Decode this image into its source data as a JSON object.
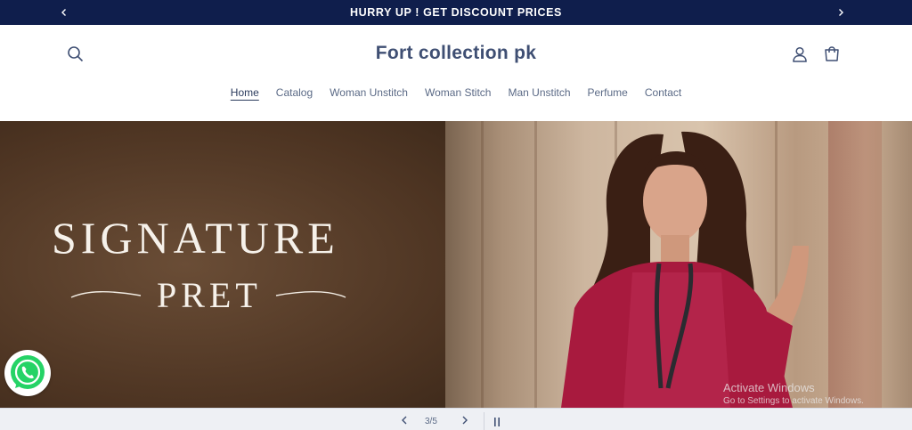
{
  "announcement": {
    "message": "HURRY UP ! GET DISCOUNT PRICES",
    "prev_icon": "chevron-left-icon",
    "next_icon": "chevron-right-icon"
  },
  "header": {
    "brand": "Fort collection pk",
    "search_icon": "search-icon",
    "account_icon": "account-icon",
    "cart_icon": "cart-icon"
  },
  "nav": {
    "items": [
      {
        "label": "Home",
        "active": true
      },
      {
        "label": "Catalog"
      },
      {
        "label": "Woman Unstitch"
      },
      {
        "label": "Woman Stitch"
      },
      {
        "label": "Man Unstitch"
      },
      {
        "label": "Perfume"
      },
      {
        "label": "Contact"
      }
    ]
  },
  "hero": {
    "line1": "SIGNATURE",
    "line2": "PRET"
  },
  "watermark": {
    "line1": "Activate Windows",
    "line2": "Go to Settings to activate Windows."
  },
  "slider": {
    "counter": "3/5",
    "prev_icon": "chevron-left-icon",
    "next_icon": "chevron-right-icon",
    "pause_icon": "pause-icon"
  },
  "whatsapp_icon": "whatsapp-icon",
  "colors": {
    "announce_bg": "#0f1e4c",
    "brand_text": "#3f4f73",
    "nav_text": "#5b6a86",
    "whatsapp_green": "#25d366"
  }
}
